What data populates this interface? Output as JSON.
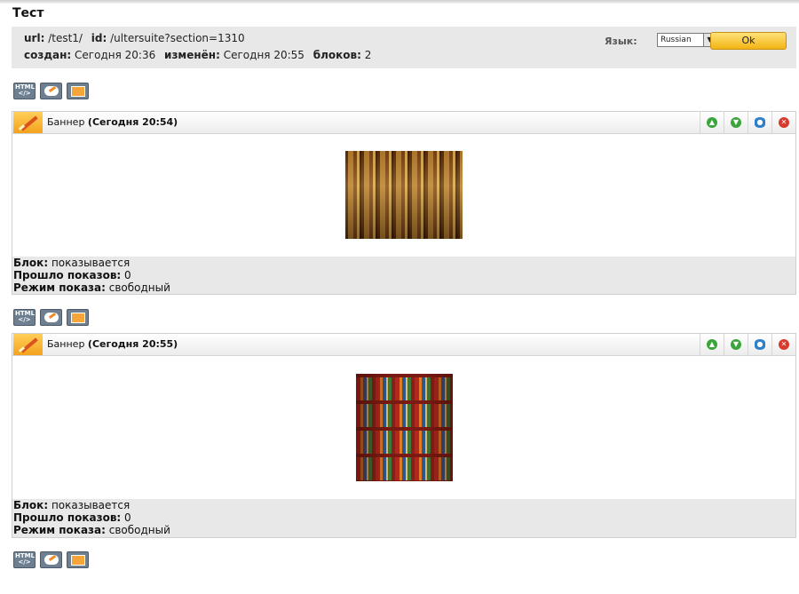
{
  "page": {
    "title": "Тест"
  },
  "info": {
    "url_label": "url:",
    "url_value": "/test1/",
    "id_label": "id:",
    "id_value": "/ultersuite?section=1310",
    "created_label": "создан:",
    "created_value": "Сегодня 20:36",
    "modified_label": "изменён:",
    "modified_value": "Сегодня 20:55",
    "blocks_label": "блоков:",
    "blocks_value": "2",
    "lang_label": "Язык:",
    "lang_selected": "Russian",
    "ok_label": "Ok"
  },
  "toolbar": {
    "html_icon_text": "HTML </>"
  },
  "banners": [
    {
      "type": "Баннер",
      "date": "(Сегодня 20:54)",
      "block_label": "Блок:",
      "block_value": "показывается",
      "shows_label": "Прошло показов:",
      "shows_value": "0",
      "mode_label": "Режим показа:",
      "mode_value": "свободный"
    },
    {
      "type": "Баннер",
      "date": "(Сегодня 20:55)",
      "block_label": "Блок:",
      "block_value": "показывается",
      "shows_label": "Прошло показов:",
      "shows_value": "0",
      "mode_label": "Режим показа:",
      "mode_value": "свободный"
    }
  ],
  "icons": {
    "up": "arrow-up-icon",
    "down": "arrow-down-icon",
    "view": "eye-icon",
    "delete": "close-icon"
  },
  "colors": {
    "accent_orange": "#f4a21e",
    "ok_button": "#f3b413",
    "action_green": "#3aa53a",
    "action_blue": "#2f7fc9",
    "action_red": "#d83a2e",
    "panel_gray": "#e8e8e8"
  }
}
